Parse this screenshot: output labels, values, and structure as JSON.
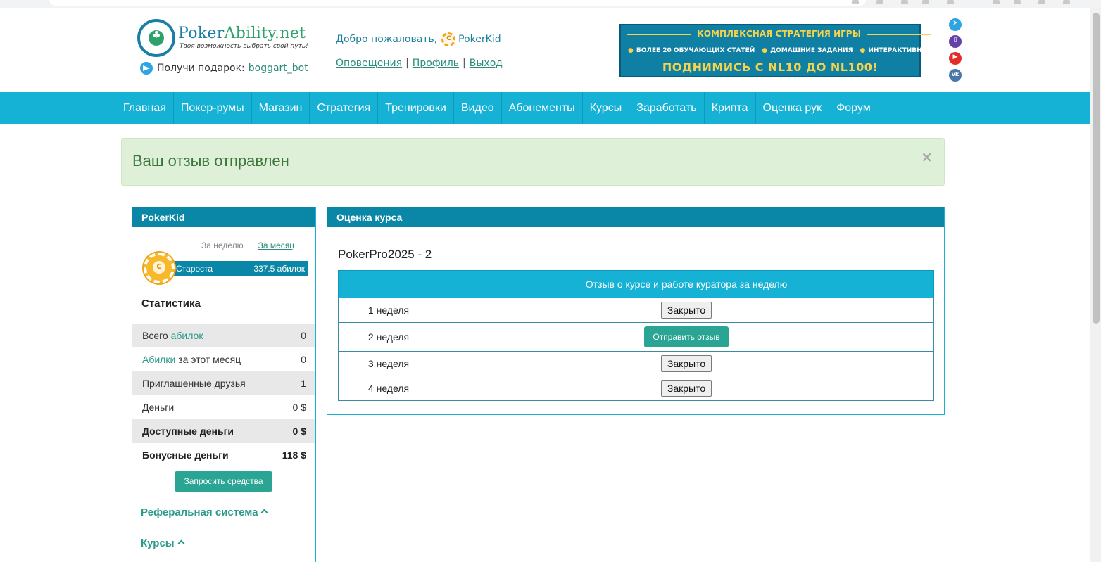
{
  "logo": {
    "title_a": "Poker",
    "title_b": "Ability.net",
    "tagline": "Твоя возможность выбрать свой путь!"
  },
  "gift": {
    "label": "Получи подарок:",
    "link": "boggart_bot"
  },
  "welcome": {
    "text": "Добро пожаловать,",
    "username": "PokerKid"
  },
  "user_nav": {
    "notifications": "Оповещения",
    "sep": "|",
    "profile": "Профиль",
    "logout": "Выход"
  },
  "banner": {
    "line1": "КОМПЛЕКСНАЯ СТРАТЕГИЯ ИГРЫ",
    "item1": "БОЛЕЕ 20 ОБУЧАЮЩИХ СТАТЕЙ",
    "item2": "ДОМАШНИЕ ЗАДАНИЯ",
    "item3": "ИНТЕРАКТИВНЫЕ ТЕСТЫ",
    "line3": "ПОДНИМИСЬ С NL10 ДО NL100!"
  },
  "nav": [
    "Главная",
    "Покер-румы",
    "Магазин",
    "Стратегия",
    "Тренировки",
    "Видео",
    "Абонементы",
    "Курсы",
    "Заработать",
    "Крипта",
    "Оценка рук",
    "Форум"
  ],
  "alert": {
    "message": "Ваш отзыв отправлен",
    "close": "×"
  },
  "sidebar": {
    "title": "PokerKid",
    "period_week": "За неделю",
    "period_month": "За месяц",
    "rank_name": "Староста",
    "rank_points": "337.5 абилок",
    "stats_title": "Статистика",
    "stats": [
      {
        "pre": "Всего ",
        "hl": "абилок",
        "post": "",
        "value": "0"
      },
      {
        "pre": "",
        "hl": "Абилки",
        "post": " за этот месяц",
        "value": "0"
      },
      {
        "pre": "Приглашенные друзья",
        "hl": "",
        "post": "",
        "value": "1"
      },
      {
        "pre": "Деньги",
        "hl": "",
        "post": "",
        "value": "0 $"
      },
      {
        "pre": "Доступные деньги",
        "hl": "",
        "post": "",
        "value": "0 $"
      },
      {
        "pre": "Бонусные деньги",
        "hl": "",
        "post": "",
        "value": "118 $"
      }
    ],
    "request_button": "Запросить средства",
    "referral": "Реферальная система",
    "courses": "Курсы"
  },
  "panel": {
    "title": "Оценка курса",
    "course": "PokerPro2025 - 2",
    "header": "Отзыв о курсе и работе куратора за неделю",
    "rows": [
      {
        "week": "1 неделя",
        "action": "Закрыто",
        "type": "closed"
      },
      {
        "week": "2 неделя",
        "action": "Отправить отзыв",
        "type": "send"
      },
      {
        "week": "3 неделя",
        "action": "Закрыто",
        "type": "closed"
      },
      {
        "week": "4 неделя",
        "action": "Закрыто",
        "type": "closed"
      }
    ]
  }
}
